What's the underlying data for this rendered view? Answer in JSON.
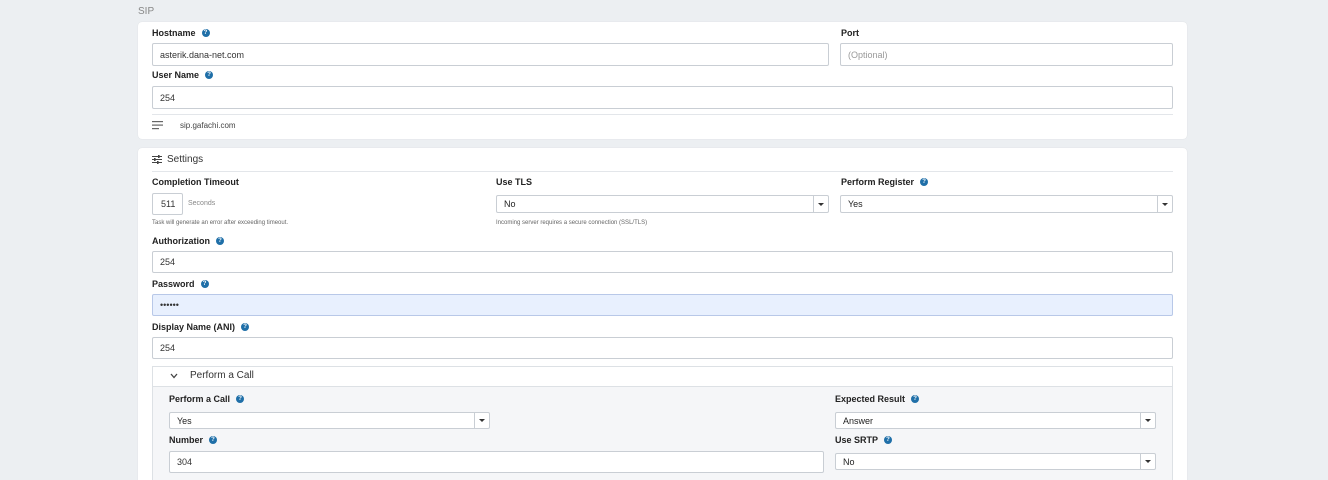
{
  "sip": {
    "section_title": "SIP",
    "hostname": {
      "label": "Hostname",
      "value": "asterik.dana-net.com"
    },
    "port": {
      "label": "Port",
      "placeholder": "(Optional)"
    },
    "username": {
      "label": "User Name",
      "value": "254"
    },
    "server_note": "sip.gafachi.com"
  },
  "settings": {
    "title": "Settings",
    "completion_timeout": {
      "label": "Completion Timeout",
      "value": "511",
      "unit": "Seconds",
      "hint": "Task will generate an error after exceeding timeout."
    },
    "use_tls": {
      "label": "Use TLS",
      "value": "No",
      "hint": "Incoming server requires a secure connection (SSL/TLS)"
    },
    "perform_register": {
      "label": "Perform Register",
      "value": "Yes"
    },
    "authorization": {
      "label": "Authorization",
      "value": "254"
    },
    "password": {
      "label": "Password",
      "value": "••••••"
    },
    "display_name": {
      "label": "Display Name (ANI)",
      "value": "254"
    }
  },
  "perform_call_section": {
    "title": "Perform a Call",
    "perform_call": {
      "label": "Perform a Call",
      "value": "Yes"
    },
    "expected_result": {
      "label": "Expected Result",
      "value": "Answer"
    },
    "number": {
      "label": "Number",
      "value": "304"
    },
    "use_srtp": {
      "label": "Use SRTP",
      "value": "No"
    }
  },
  "icons": {
    "help": "?"
  },
  "colors": {
    "help_icon": "#1f6fa8",
    "page_bg": "#eceff2",
    "password_bg": "#e8f0fe"
  }
}
